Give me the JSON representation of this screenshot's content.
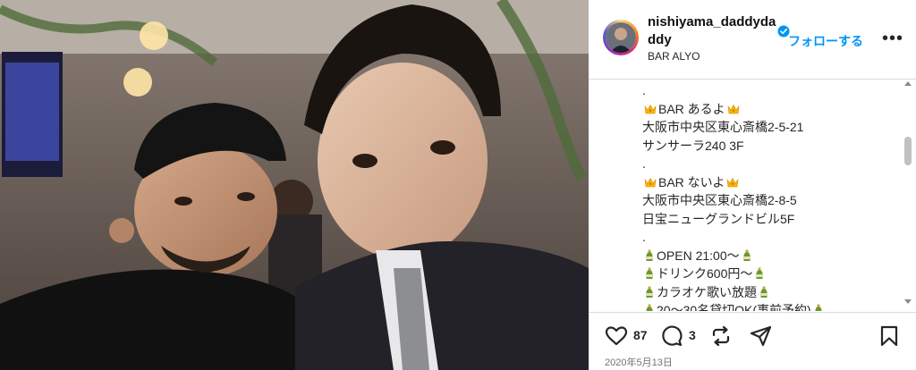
{
  "post": {
    "username": "nishiyama_daddyda\nddy",
    "follow_label": "フォローする",
    "more_label": "•••",
    "location": "BAR ALYO",
    "caption_lines": [
      {
        "prefix": "",
        "text": ".",
        "suffix": ""
      },
      {
        "prefix": "crown",
        "text": "BAR あるよ",
        "suffix": "crown"
      },
      {
        "prefix": "",
        "text": "大阪市中央区東心斎橋2-5-21",
        "suffix": ""
      },
      {
        "prefix": "",
        "text": "サンサーラ240  3F",
        "suffix": ""
      },
      {
        "prefix": "",
        "text": ".",
        "suffix": ""
      },
      {
        "prefix": "crown",
        "text": "BAR ないよ",
        "suffix": "crown"
      },
      {
        "prefix": "",
        "text": "大阪市中央区東心斎橋2-8-5",
        "suffix": ""
      },
      {
        "prefix": "",
        "text": "日宝ニューグランドビル5F",
        "suffix": ""
      },
      {
        "prefix": "",
        "text": ".",
        "suffix": ""
      },
      {
        "prefix": "bottle",
        "text": "OPEN 21:00〜",
        "suffix": "bottle"
      },
      {
        "prefix": "bottle",
        "text": "ドリンク600円〜",
        "suffix": "bottle"
      },
      {
        "prefix": "bottle",
        "text": "カラオケ歌い放題",
        "suffix": "bottle"
      },
      {
        "prefix": "bottle",
        "text": "20〜30名貸切OK(事前予約)",
        "suffix": "bottle"
      }
    ],
    "likes_count": "87",
    "comments_count": "3",
    "date": "2020年5月13日"
  },
  "colors": {
    "accent": "#0095f6",
    "verified": "#0095f6"
  },
  "icons": [
    "verified-badge-icon",
    "heart-icon",
    "comment-icon",
    "repost-icon",
    "share-icon",
    "bookmark-icon",
    "crown-emoji-icon",
    "bottle-emoji-icon"
  ]
}
